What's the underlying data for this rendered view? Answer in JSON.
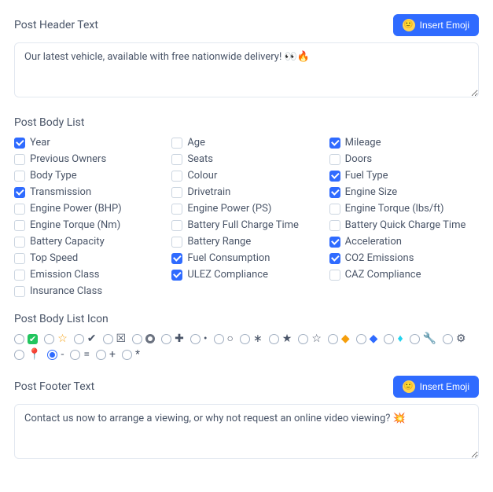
{
  "header": {
    "title": "Post Header Text",
    "emoji_btn": "Insert Emoji",
    "value": "Our latest vehicle, available with free nationwide delivery! 👀🔥"
  },
  "bodylist": {
    "title": "Post Body List",
    "items": [
      {
        "label": "Year",
        "checked": true
      },
      {
        "label": "Age",
        "checked": false
      },
      {
        "label": "Mileage",
        "checked": true
      },
      {
        "label": "Previous Owners",
        "checked": false
      },
      {
        "label": "Seats",
        "checked": false
      },
      {
        "label": "Doors",
        "checked": false
      },
      {
        "label": "Body Type",
        "checked": false
      },
      {
        "label": "Colour",
        "checked": false
      },
      {
        "label": "Fuel Type",
        "checked": true
      },
      {
        "label": "Transmission",
        "checked": true
      },
      {
        "label": "Drivetrain",
        "checked": false
      },
      {
        "label": "Engine Size",
        "checked": true
      },
      {
        "label": "Engine Power (BHP)",
        "checked": false
      },
      {
        "label": "Engine Power (PS)",
        "checked": false
      },
      {
        "label": "Engine Torque (lbs/ft)",
        "checked": false
      },
      {
        "label": "Engine Torque (Nm)",
        "checked": false
      },
      {
        "label": "Battery Full Charge Time",
        "checked": false
      },
      {
        "label": "Battery Quick Charge Time",
        "checked": false
      },
      {
        "label": "Battery Capacity",
        "checked": false
      },
      {
        "label": "Battery Range",
        "checked": false
      },
      {
        "label": "Acceleration",
        "checked": true
      },
      {
        "label": "Top Speed",
        "checked": false
      },
      {
        "label": "Fuel Consumption",
        "checked": true
      },
      {
        "label": "CO2 Emissions",
        "checked": true
      },
      {
        "label": "Emission Class",
        "checked": false
      },
      {
        "label": "ULEZ Compliance",
        "checked": true
      },
      {
        "label": "CAZ Compliance",
        "checked": false
      },
      {
        "label": "Insurance Class",
        "checked": false
      }
    ]
  },
  "iconlist": {
    "title": "Post Body List Icon",
    "items": [
      {
        "name": "green-check",
        "glyph": "✔",
        "cls": "green-check",
        "checked": false
      },
      {
        "name": "star-gold",
        "glyph": "☆",
        "cls": "gold",
        "checked": false
      },
      {
        "name": "check-mark",
        "glyph": "✔",
        "cls": "",
        "checked": false
      },
      {
        "name": "ballot",
        "glyph": "☒",
        "cls": "",
        "checked": false
      },
      {
        "name": "ring",
        "glyph": "",
        "cls": "ring",
        "checked": false
      },
      {
        "name": "plus-bold",
        "glyph": "✚",
        "cls": "",
        "checked": false
      },
      {
        "name": "bullet",
        "glyph": "•",
        "cls": "",
        "checked": false
      },
      {
        "name": "small-circle",
        "glyph": "○",
        "cls": "",
        "checked": false
      },
      {
        "name": "asterisk",
        "glyph": "∗",
        "cls": "",
        "checked": false
      },
      {
        "name": "star-black",
        "glyph": "★",
        "cls": "",
        "checked": false
      },
      {
        "name": "star-outline",
        "glyph": "☆",
        "cls": "",
        "checked": false
      },
      {
        "name": "diamond-gold",
        "glyph": "◆",
        "cls": "gold",
        "checked": false
      },
      {
        "name": "diamond-blue",
        "glyph": "◆",
        "cls": "blue-dia",
        "checked": false
      },
      {
        "name": "gem",
        "glyph": "♦",
        "cls": "cyan-dia",
        "checked": false
      },
      {
        "name": "wrench",
        "glyph": "🔧",
        "cls": "",
        "checked": false
      },
      {
        "name": "gear",
        "glyph": "⚙",
        "cls": "",
        "checked": false
      },
      {
        "name": "pin",
        "glyph": "📍",
        "cls": "red-pin",
        "checked": false
      },
      {
        "name": "dash",
        "glyph": "-",
        "cls": "",
        "checked": true
      },
      {
        "name": "equals",
        "glyph": "=",
        "cls": "",
        "checked": false
      },
      {
        "name": "plus",
        "glyph": "+",
        "cls": "",
        "checked": false
      },
      {
        "name": "star-tiny",
        "glyph": "*",
        "cls": "",
        "checked": false
      }
    ]
  },
  "footer": {
    "title": "Post Footer Text",
    "emoji_btn": "Insert Emoji",
    "value": "Contact us now to arrange a viewing, or why not request an online video viewing? 💥"
  }
}
